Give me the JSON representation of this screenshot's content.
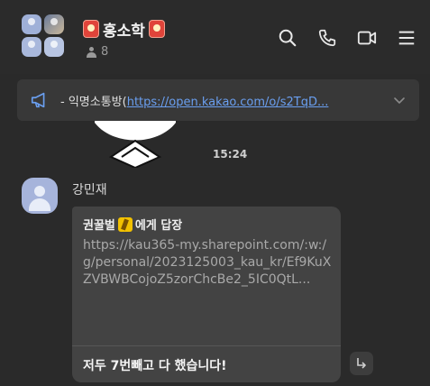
{
  "header": {
    "title": "홍소학",
    "member_count": "8",
    "icons": [
      "search-icon",
      "phone-icon",
      "video-icon",
      "menu-icon"
    ]
  },
  "notice": {
    "prefix": "- 익명소통방(",
    "link_text": "https://open.kakao.com/o/s2TqD..."
  },
  "chat": {
    "time": "15:24",
    "message": {
      "sender": "강민재",
      "reply_to_prefix": "권꿀벌",
      "reply_to_suffix": "에게 답장",
      "quoted_text": "https://kau365-my.sharepoint.com/:w:/g/personal/2023125003_kau_kr/Ef9KuXZVBWBCojoZ5zorChcBe2_5IC0QtL...",
      "reply_text": "저두 7번빼고 다 했습니다!"
    }
  },
  "colors": {
    "background": "#2a2a2a",
    "bubble": "#434343",
    "link": "#6a9ff0"
  }
}
